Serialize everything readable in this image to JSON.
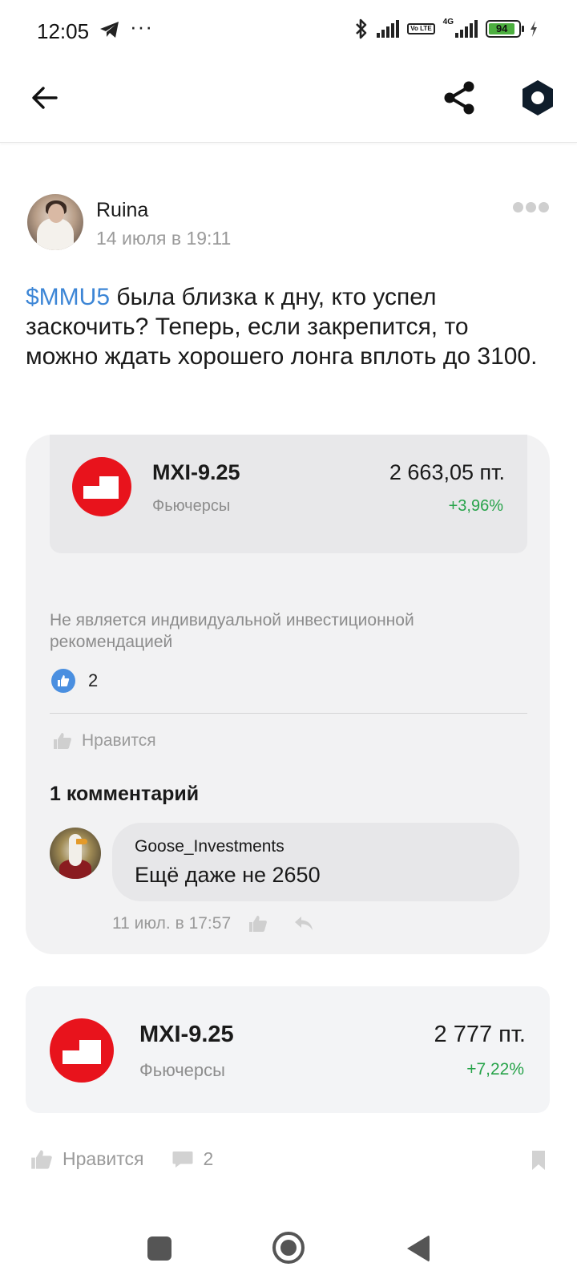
{
  "status_bar": {
    "time": "12:05",
    "overflow": "···",
    "network": "4G",
    "volte": "Vo LTE",
    "battery": "94"
  },
  "app_bar": {
    "back_icon": "arrow-left-icon",
    "share_icon": "share-icon",
    "settings_icon": "hexagon-settings-icon"
  },
  "post": {
    "author": "Ruina",
    "date": "14 июля в 19:11",
    "ticker": "$MMU5",
    "text": " была близка к дну, кто успел заскочить? Теперь, если закрепится, то можно ждать хорошего лонга вплоть до 3100.",
    "embedded_quote": {
      "title": "MXI-9.25",
      "subtitle": "Фьючерсы",
      "price": "2 663,05  пт.",
      "change": "+3,96%"
    },
    "disclaimer": "Не является индивидуальной инвестиционной рекомендацией",
    "likes_count": "2",
    "like_label": "Нравится",
    "comments_title": "1 комментарий",
    "comment": {
      "author": "Goose_Investments",
      "text": "Ещё даже не 2650",
      "date": "11 июл. в 17:57"
    }
  },
  "quote_card": {
    "title": "MXI-9.25",
    "subtitle": "Фьючерсы",
    "price": "2 777  пт.",
    "change": "+7,22%"
  },
  "actions": {
    "like_label": "Нравится",
    "comments_count": "2"
  },
  "colors": {
    "accent_link": "#3d86d6",
    "positive": "#27a34a",
    "moex_red": "#e8131c",
    "like_blue": "#4a8fe0"
  }
}
